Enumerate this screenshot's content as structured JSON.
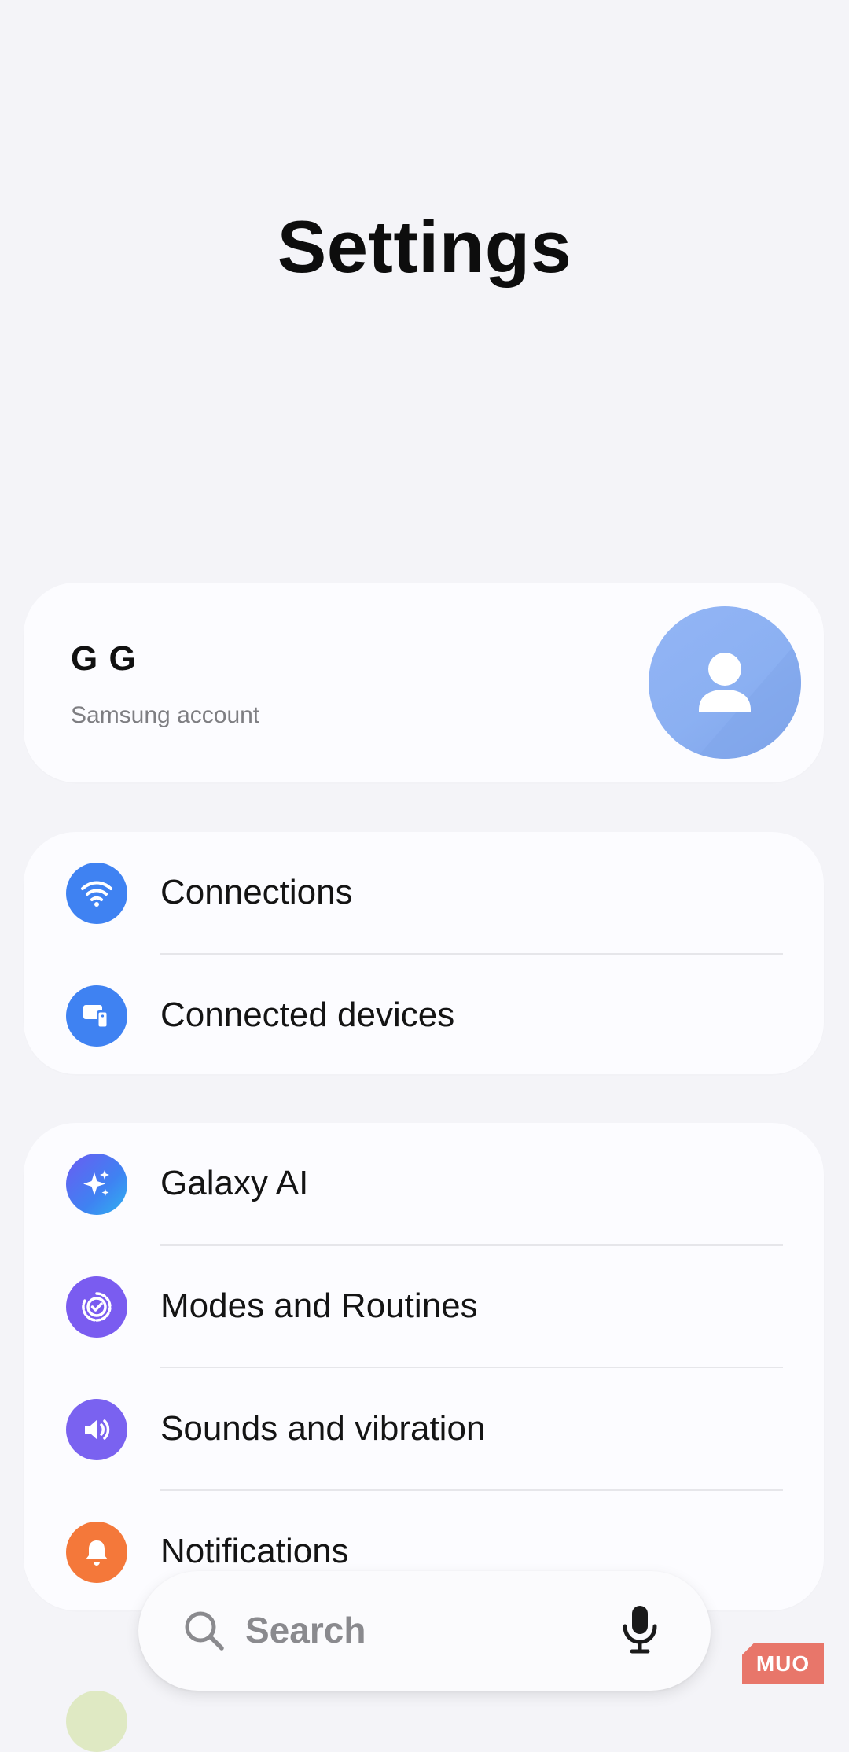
{
  "header": {
    "title": "Settings"
  },
  "account": {
    "name": "G G",
    "subtitle": "Samsung account",
    "avatar_icon": "person-icon",
    "avatar_color": "#8fb2f4"
  },
  "groups": [
    {
      "items": [
        {
          "label": "Connections",
          "icon": "wifi-icon",
          "color": "#3f82f2"
        },
        {
          "label": "Connected devices",
          "icon": "devices-icon",
          "color": "#3f82f2"
        }
      ]
    },
    {
      "items": [
        {
          "label": "Galaxy AI",
          "icon": "sparkle-icon",
          "color": "#4a6ff2"
        },
        {
          "label": "Modes and Routines",
          "icon": "check-circle-icon",
          "color": "#7a5cf0"
        },
        {
          "label": "Sounds and vibration",
          "icon": "volume-icon",
          "color": "#7a62f0"
        },
        {
          "label": "Notifications",
          "icon": "bell-icon",
          "color": "#f4783a"
        }
      ]
    }
  ],
  "search": {
    "placeholder": "Search",
    "icon": "search-icon",
    "mic_icon": "mic-icon"
  },
  "watermark": {
    "text": "MUO"
  }
}
